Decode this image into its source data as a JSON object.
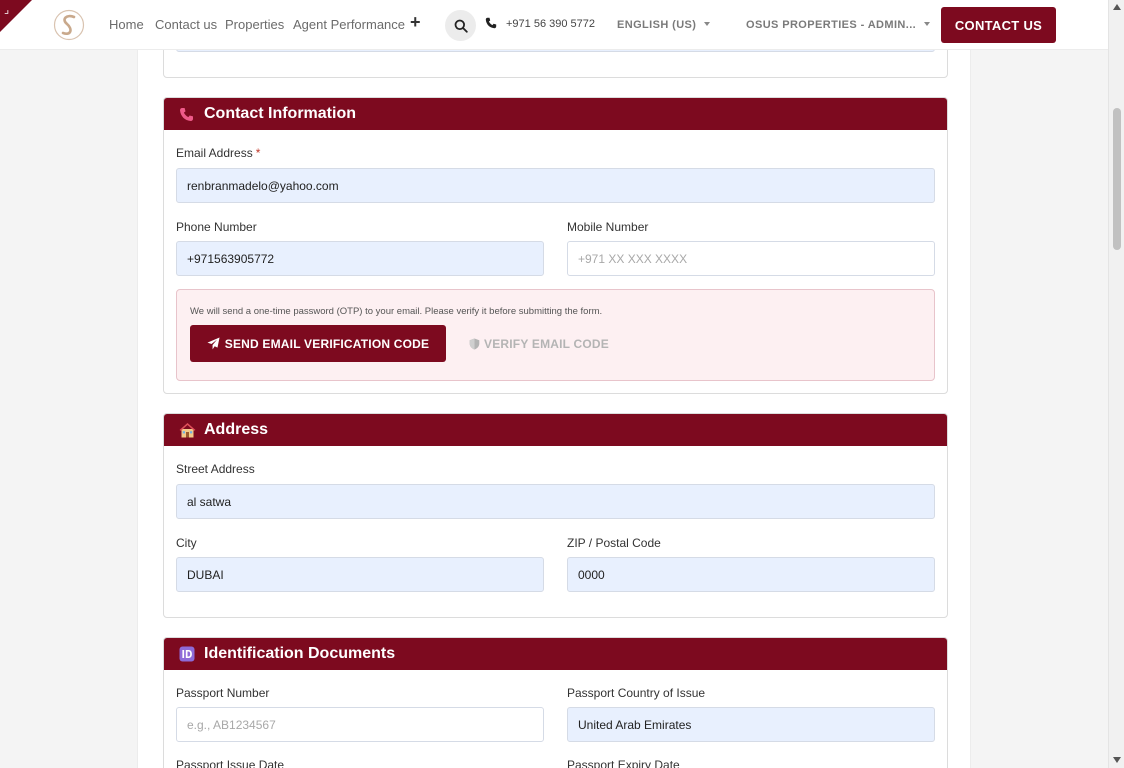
{
  "nav": {
    "links": [
      "Home",
      "Contact us",
      "Properties",
      "Agent Performance"
    ],
    "phone": "+971 56 390 5772",
    "language": "ENGLISH (US)",
    "account": "OSUS PROPERTIES - ADMIN...",
    "contact_button": "CONTACT US"
  },
  "contact": {
    "title": "Contact Information",
    "email_label": "Email Address",
    "required_mark": "*",
    "email_value": "renbranmadelo@yahoo.com",
    "phone_label": "Phone Number",
    "phone_value": "+971563905772",
    "mobile_label": "Mobile Number",
    "mobile_placeholder": "+971 XX XXX XXXX",
    "otp_note": "We will send a one-time password (OTP) to your email. Please verify it before submitting the form.",
    "send_button": "SEND EMAIL VERIFICATION CODE",
    "verify_button": "VERIFY EMAIL CODE"
  },
  "address": {
    "title": "Address",
    "street_label": "Street Address",
    "street_value": "al satwa",
    "city_label": "City",
    "city_value": "DUBAI",
    "zip_label": "ZIP / Postal Code",
    "zip_value": "0000"
  },
  "identification": {
    "title": "Identification Documents",
    "passport_number_label": "Passport Number",
    "passport_number_placeholder": "e.g., AB1234567",
    "passport_country_label": "Passport Country of Issue",
    "passport_country_value": "United Arab Emirates",
    "issue_date_label": "Passport Issue Date",
    "expiry_date_label": "Passport Expiry Date"
  },
  "colors": {
    "brand": "#7d0a1f",
    "filled_input": "#e8f0fe",
    "otp_background": "#fdf0f2"
  }
}
